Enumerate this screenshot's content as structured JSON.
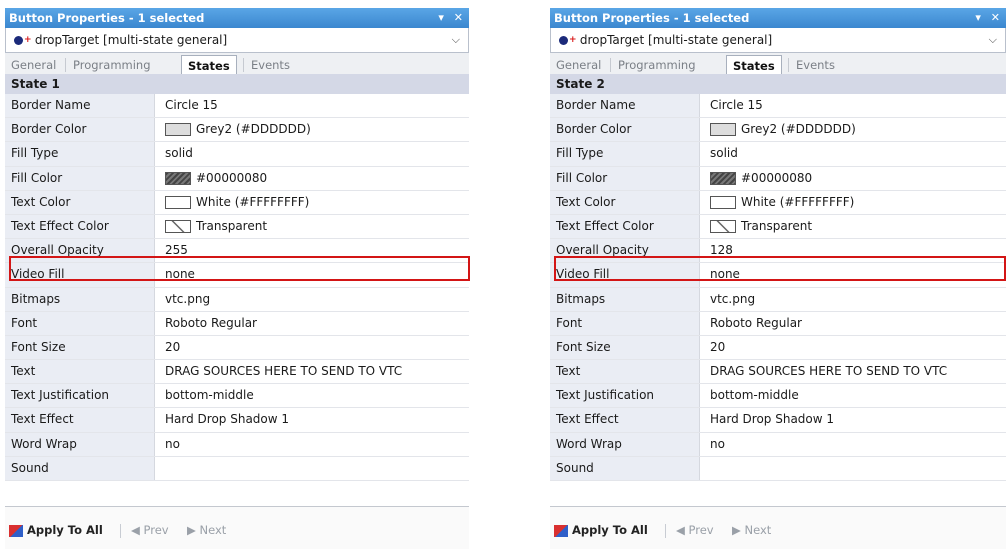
{
  "panels": [
    {
      "title": "Button Properties - 1 selected",
      "title_controls": [
        "▾",
        "✕"
      ],
      "selector": "dropTarget  [multi-state general]",
      "tabs": [
        "General",
        "Programming",
        "States",
        "Events"
      ],
      "active_tab": "States",
      "state_header": "State 1",
      "rows": [
        {
          "name": "Border Name",
          "value": "Circle 15"
        },
        {
          "name": "Border Color",
          "value": "Grey2 (#DDDDDD)",
          "swatch": "grey"
        },
        {
          "name": "Fill Type",
          "value": "solid"
        },
        {
          "name": "Fill Color",
          "value": "#00000080",
          "swatch": "dark"
        },
        {
          "name": "Text Color",
          "value": "White (#FFFFFFFF)",
          "swatch": "white"
        },
        {
          "name": "Text Effect Color",
          "value": "Transparent",
          "swatch": "trans"
        },
        {
          "name": "Overall Opacity",
          "value": "255",
          "highlight": true
        },
        {
          "name": "Video Fill",
          "value": "none"
        },
        {
          "name": "Bitmaps",
          "value": "vtc.png"
        },
        {
          "name": "Font",
          "value": "Roboto Regular"
        },
        {
          "name": "Font Size",
          "value": "20"
        },
        {
          "name": "Text",
          "value": "DRAG SOURCES HERE TO SEND TO VTC"
        },
        {
          "name": "Text Justification",
          "value": "bottom-middle"
        },
        {
          "name": "Text Effect",
          "value": "Hard Drop Shadow 1"
        },
        {
          "name": "Word Wrap",
          "value": "no"
        },
        {
          "name": "Sound",
          "value": ""
        }
      ],
      "footer": {
        "apply": "Apply To All",
        "prev": "Prev",
        "next": "Next"
      }
    },
    {
      "title": "Button Properties - 1 selected",
      "title_controls": [
        "▾",
        "✕"
      ],
      "selector": "dropTarget  [multi-state general]",
      "tabs": [
        "General",
        "Programming",
        "States",
        "Events"
      ],
      "active_tab": "States",
      "state_header": "State 2",
      "rows": [
        {
          "name": "Border Name",
          "value": "Circle 15"
        },
        {
          "name": "Border Color",
          "value": "Grey2 (#DDDDDD)",
          "swatch": "grey"
        },
        {
          "name": "Fill Type",
          "value": "solid"
        },
        {
          "name": "Fill Color",
          "value": "#00000080",
          "swatch": "dark"
        },
        {
          "name": "Text Color",
          "value": "White (#FFFFFFFF)",
          "swatch": "white"
        },
        {
          "name": "Text Effect Color",
          "value": "Transparent",
          "swatch": "trans"
        },
        {
          "name": "Overall Opacity",
          "value": "128",
          "highlight": true
        },
        {
          "name": "Video Fill",
          "value": "none"
        },
        {
          "name": "Bitmaps",
          "value": "vtc.png"
        },
        {
          "name": "Font",
          "value": "Roboto Regular"
        },
        {
          "name": "Font Size",
          "value": "20"
        },
        {
          "name": "Text",
          "value": "DRAG SOURCES HERE TO SEND TO VTC"
        },
        {
          "name": "Text Justification",
          "value": "bottom-middle"
        },
        {
          "name": "Text Effect",
          "value": "Hard Drop Shadow 1"
        },
        {
          "name": "Word Wrap",
          "value": "no"
        },
        {
          "name": "Sound",
          "value": ""
        }
      ],
      "footer": {
        "apply": "Apply To All",
        "prev": "Prev",
        "next": "Next"
      }
    }
  ],
  "colors": {
    "titlebar": "#3b87cf",
    "highlight": "#d31515",
    "state_header": "#d4d8e6"
  }
}
